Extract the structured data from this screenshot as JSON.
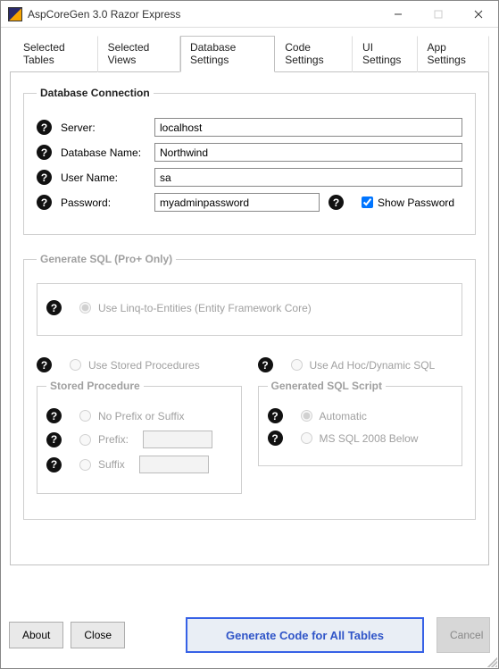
{
  "window": {
    "title": "AspCoreGen 3.0 Razor Express"
  },
  "tabs": {
    "items": [
      "Selected Tables",
      "Selected Views",
      "Database Settings",
      "Code Settings",
      "UI Settings",
      "App Settings"
    ],
    "active_index": 2
  },
  "db_conn": {
    "legend": "Database Connection",
    "server_label": "Server:",
    "server_value": "localhost",
    "dbname_label": "Database Name:",
    "dbname_value": "Northwind",
    "user_label": "User Name:",
    "user_value": "sa",
    "password_label": "Password:",
    "password_value": "myadminpassword",
    "show_password_label": "Show Password",
    "show_password_checked": true
  },
  "gen_sql": {
    "legend": "Generate SQL (Pro+ Only)",
    "linq_label": "Use Linq-to-Entities (Entity Framework Core)",
    "linq_selected": true,
    "storedproc_label": "Use Stored Procedures",
    "adhoc_label": "Use Ad Hoc/Dynamic SQL",
    "sp_fieldset": {
      "legend": "Stored Procedure",
      "noprefix_label": "No Prefix or Suffix",
      "prefix_label": "Prefix:",
      "prefix_value": "",
      "suffix_label": "Suffix",
      "suffix_value": ""
    },
    "script_fieldset": {
      "legend": "Generated SQL Script",
      "automatic_label": "Automatic",
      "automatic_selected": true,
      "mssql_label": "MS SQL 2008 Below"
    }
  },
  "footer": {
    "about": "About",
    "close": "Close",
    "generate": "Generate Code for All Tables",
    "cancel": "Cancel"
  }
}
